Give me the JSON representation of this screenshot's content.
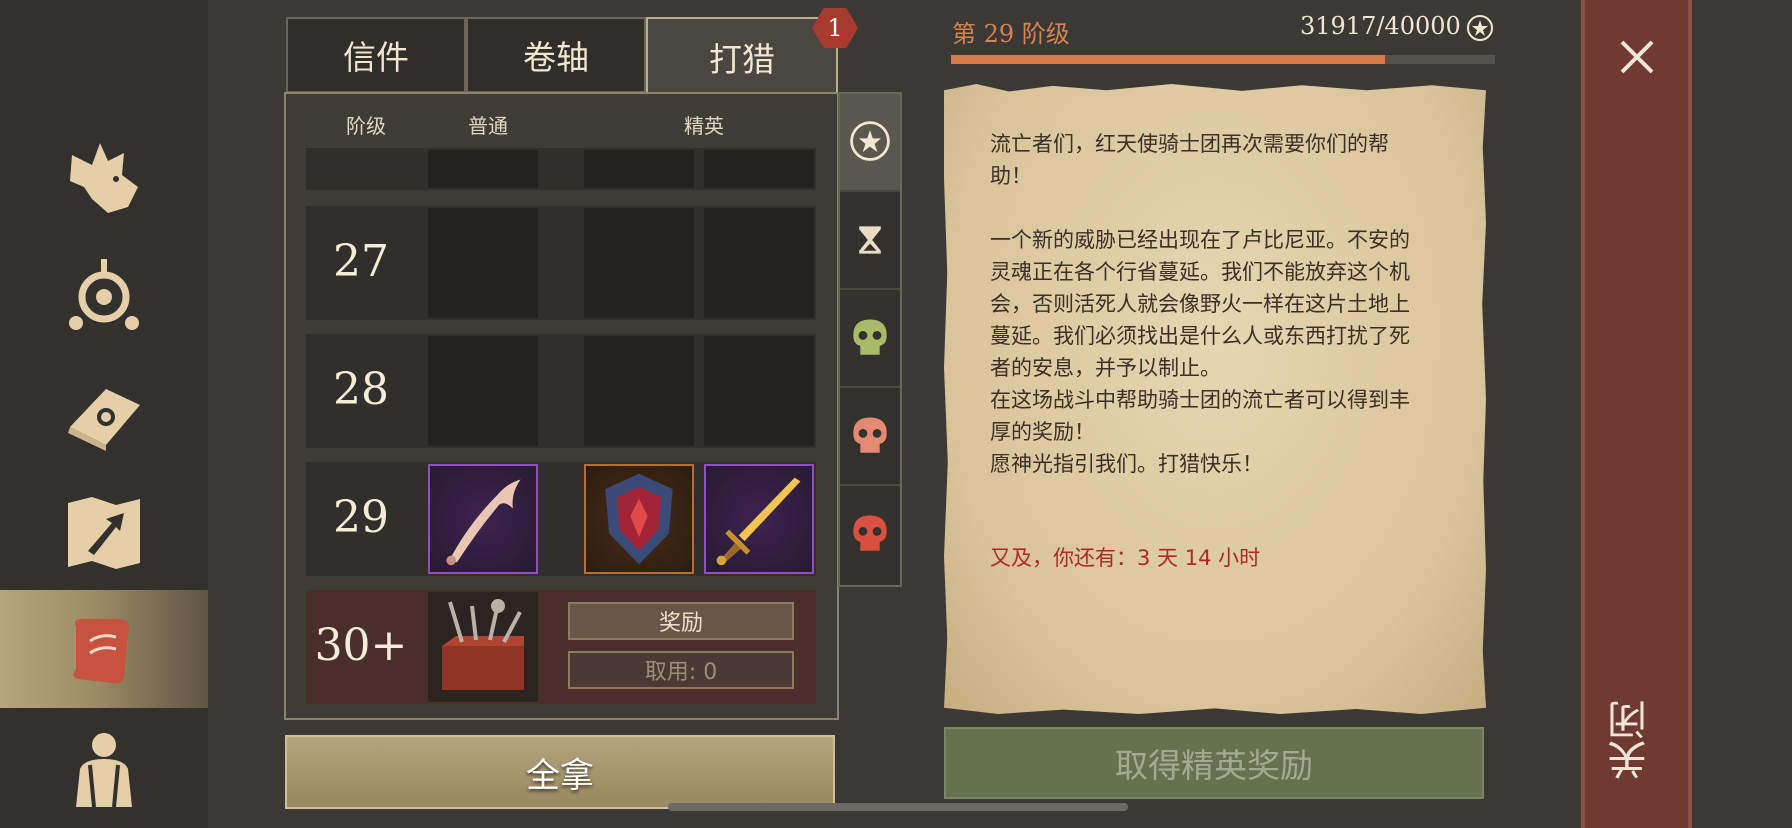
{
  "sidebar": {
    "items": [
      {
        "icon": "wolf-head-icon"
      },
      {
        "icon": "crosshair-orb-icon"
      },
      {
        "icon": "sun-book-icon"
      },
      {
        "icon": "map-arrow-icon"
      },
      {
        "icon": "scroll-quill-icon",
        "active": true
      },
      {
        "icon": "hero-silhouette-icon"
      }
    ]
  },
  "tabs": [
    {
      "label": "信件"
    },
    {
      "label": "卷轴"
    },
    {
      "label": "打猎",
      "active": true
    }
  ],
  "tab_badge": "1",
  "table": {
    "headers": {
      "tier": "阶级",
      "normal": "普通",
      "elite": "精英"
    },
    "rows": [
      {
        "tier": "27"
      },
      {
        "tier": "28"
      },
      {
        "tier": "29",
        "items": [
          "bone-scythe-icon",
          "dragon-shield-icon",
          "golden-sword-icon"
        ]
      }
    ],
    "reward_row": {
      "tier": "30+",
      "icon": "weapon-chest-icon",
      "reward_label": "奖励",
      "claimed_label": "取用: 0"
    }
  },
  "take_all_label": "全拿",
  "side_icons": [
    "laurel-star-icon",
    "hourglass-icon",
    "skull-green-icon",
    "skull-orange-icon",
    "skull-red-icon"
  ],
  "progress": {
    "level_label": "第 29 阶级",
    "xp_text": "31917/40000",
    "current": 31917,
    "max": 40000
  },
  "letter": {
    "body": "流亡者们，红天使骑士团再次需要你们的帮助！\n\n一个新的威胁已经出现在了卢比尼亚。不安的灵魂正在各个行省蔓延。我们不能放弃这个机会，否则活死人就会像野火一样在这片土地上蔓延。我们必须找出是什么人或东西打扰了死者的安息，并予以制止。\n在这场战斗中帮助骑士团的流亡者可以得到丰厚的奖励！\n愿神光指引我们。打猎快乐！",
    "timer": "又及，你还有：3 天 14 小时"
  },
  "elite_button_label": "取得精英奖励",
  "close_label": "关闭",
  "colors": {
    "accent": "#d97a4a",
    "epic": "#8f4fc2",
    "legendary": "#b76f2c",
    "timer_red": "#b02a22"
  }
}
